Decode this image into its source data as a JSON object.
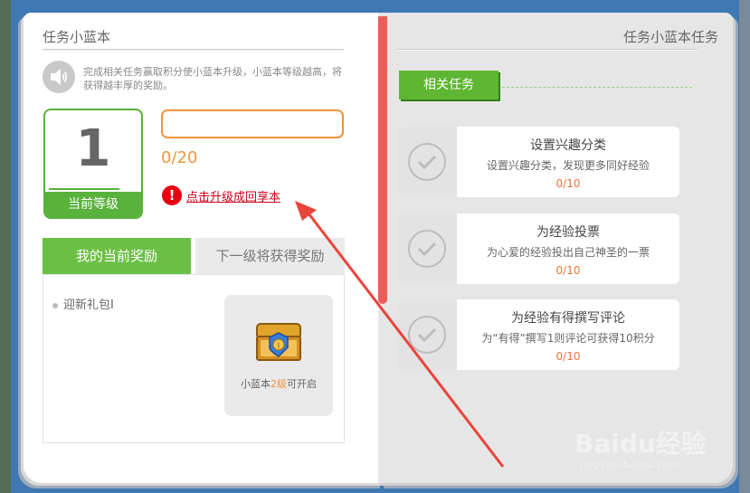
{
  "left_page": {
    "title": "任务小蓝本",
    "description": "完成相关任务赢取积分使小蓝本升级，小蓝本等级越高，将获得越丰厚的奖励。",
    "level": {
      "value": "1",
      "label": "当前等级"
    },
    "progress": {
      "text": "0/20",
      "fraction": 0
    },
    "upgrade_link": "点击升级成回享本",
    "tabs": {
      "current": "我的当前奖励",
      "next": "下一级将获得奖励"
    },
    "reward_item": "迎新礼包I",
    "chest": {
      "prefix": "小蓝本",
      "level": "2级",
      "suffix": "可开启"
    }
  },
  "right_page": {
    "title": "任务小蓝本任务",
    "related_label": "相关任务",
    "tasks": [
      {
        "title": "设置兴趣分类",
        "desc": "设置兴趣分类，发现更多同好经验",
        "progress": "0/10"
      },
      {
        "title": "为经验投票",
        "desc": "为心爱的经验投出自己神圣的一票",
        "progress": "0/10"
      },
      {
        "title": "为经验有得撰写评论",
        "desc": "为“有得”撰写1则评论可获得10积分",
        "progress": "0/10"
      }
    ]
  },
  "watermark": {
    "brand": "Baidu经验",
    "url": "jingyan.baidu.com"
  },
  "colors": {
    "green": "#6cbf45",
    "orange": "#f0943c",
    "red": "#e60012",
    "spine": "#ef5b5b"
  },
  "icons": [
    "speaker-icon",
    "alert-icon",
    "treasure-chest-icon",
    "checkmark-icon"
  ]
}
